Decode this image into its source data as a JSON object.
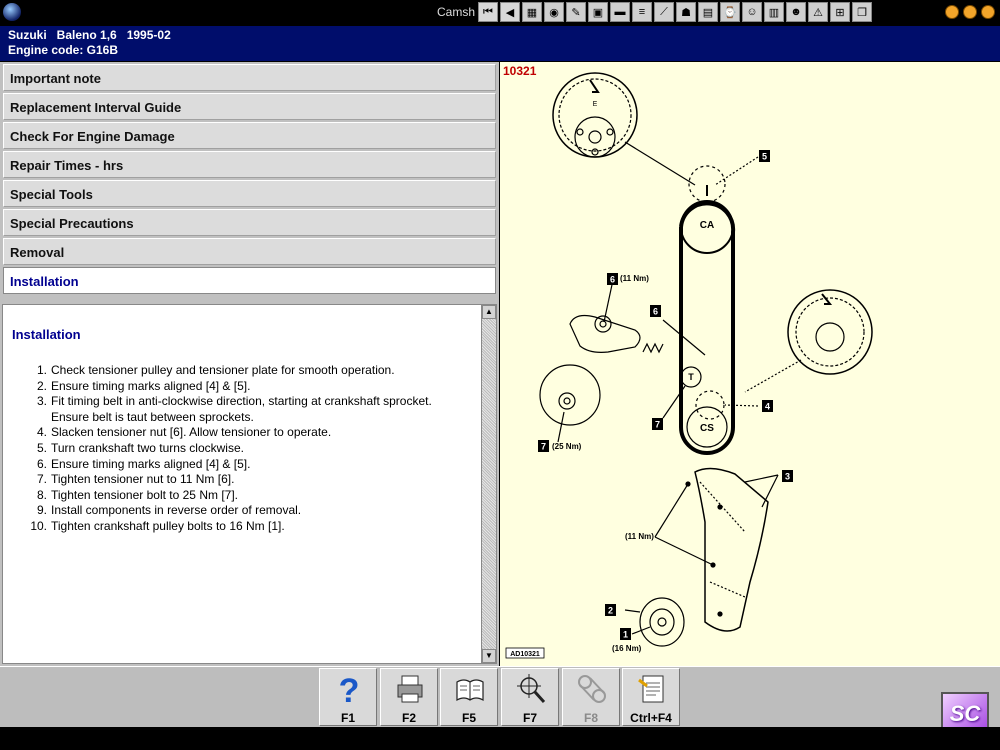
{
  "window": {
    "title": "Camsh"
  },
  "vehicle": {
    "line1": "Suzuki   Baleno 1,6   1995-02",
    "line2": "Engine code: G16B"
  },
  "menu": [
    {
      "label": "Important note"
    },
    {
      "label": "Replacement Interval Guide"
    },
    {
      "label": "Check For Engine Damage"
    },
    {
      "label": "Repair Times - hrs"
    },
    {
      "label": "Special Tools"
    },
    {
      "label": "Special Precautions"
    },
    {
      "label": "Removal"
    },
    {
      "label": "Installation"
    }
  ],
  "content": {
    "heading": "Installation",
    "steps": [
      {
        "n": "1.",
        "text": "Check tensioner pulley and tensioner plate for smooth operation."
      },
      {
        "n": "2.",
        "text": "Ensure timing marks aligned [4] & [5]."
      },
      {
        "n": "3.",
        "text": "Fit timing belt in anti-clockwise direction, starting at crankshaft sprocket."
      },
      {
        "n": "",
        "text": "Ensure belt is taut between sprockets."
      },
      {
        "n": "4.",
        "text": "Slacken tensioner nut [6]. Allow tensioner to operate."
      },
      {
        "n": "5.",
        "text": "Turn crankshaft two turns clockwise."
      },
      {
        "n": "6.",
        "text": "Ensure timing marks aligned [4] & [5]."
      },
      {
        "n": "7.",
        "text": "Tighten tensioner nut to 11 Nm [6]."
      },
      {
        "n": "8.",
        "text": "Tighten tensioner bolt to 25 Nm [7]."
      },
      {
        "n": "9.",
        "text": "Install components in reverse order of removal."
      },
      {
        "n": "10.",
        "text": "Tighten crankshaft pulley bolts to 16 Nm [1]."
      }
    ]
  },
  "diagram": {
    "number": "10321",
    "ref": "AD10321",
    "labels": {
      "ca": "CA",
      "cs": "CS",
      "t": "T",
      "c1": "1",
      "c2": "2",
      "c3": "3",
      "c4": "4",
      "c5": "5",
      "c6a": "6",
      "c6b": "6",
      "c7": "7",
      "torque_nut": "(11 Nm)",
      "torque_bolt": "(25 Nm)",
      "torque_cover": "(11 Nm)",
      "torque_pulley": "(16 Nm)",
      "e_mark": "E"
    }
  },
  "fkeys": [
    {
      "label": "F1",
      "icon": "help-icon"
    },
    {
      "label": "F2",
      "icon": "printer-icon"
    },
    {
      "label": "F5",
      "icon": "book-icon"
    },
    {
      "label": "F7",
      "icon": "crosshair-icon"
    },
    {
      "label": "F8",
      "icon": "belt-icon"
    },
    {
      "label": "Ctrl+F4",
      "icon": "clipboard-icon"
    }
  ],
  "logo": "SC"
}
